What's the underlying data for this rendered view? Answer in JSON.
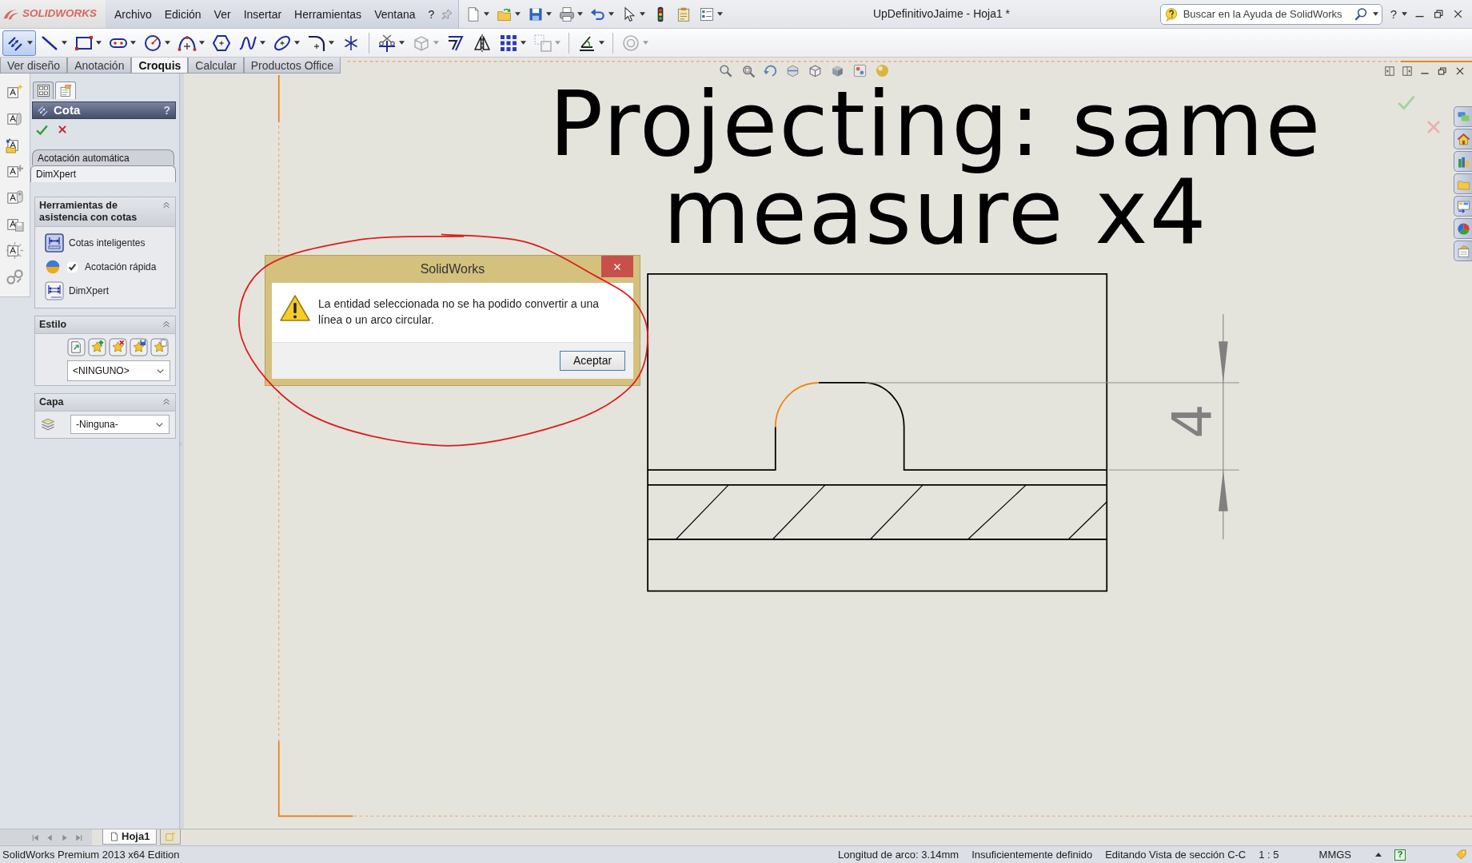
{
  "window": {
    "logo": "SOLIDWORKS",
    "menu": [
      "Archivo",
      "Edición",
      "Ver",
      "Insertar",
      "Herramientas",
      "Ventana",
      "?"
    ],
    "quick_toolbar": [
      {
        "kind": "new",
        "dropdown": true
      },
      {
        "kind": "open",
        "dropdown": true
      },
      {
        "kind": "save",
        "dropdown": true
      },
      {
        "kind": "print",
        "dropdown": true
      },
      {
        "kind": "undo",
        "dropdown": true
      },
      {
        "kind": "select",
        "dropdown": true
      },
      {
        "kind": "rebuild",
        "dropdown": false
      },
      {
        "kind": "options",
        "dropdown": false
      },
      {
        "kind": "properties",
        "dropdown": true
      }
    ],
    "title": "UpDefinitivoJaime - Hoja1 *",
    "search": {
      "placeholder": "Buscar en la Ayuda de SolidWorks"
    },
    "help": "?"
  },
  "sketch_toolbar": {
    "groups": [
      {
        "tools": [
          {
            "kind": "dimension",
            "selected": true,
            "disabled": false,
            "dropdown": true
          },
          {
            "kind": "line",
            "selected": false,
            "disabled": false,
            "dropdown": true
          },
          {
            "kind": "rectangle",
            "selected": false,
            "disabled": false,
            "dropdown": true
          },
          {
            "kind": "slot",
            "selected": false,
            "disabled": false,
            "dropdown": true
          },
          {
            "kind": "circle",
            "selected": false,
            "disabled": false,
            "dropdown": true
          },
          {
            "kind": "arc",
            "selected": false,
            "disabled": false,
            "dropdown": true
          },
          {
            "kind": "polygon",
            "selected": false,
            "disabled": false,
            "dropdown": false
          },
          {
            "kind": "spline",
            "selected": false,
            "disabled": false,
            "dropdown": true
          },
          {
            "kind": "ellipse",
            "selected": false,
            "disabled": false,
            "dropdown": true
          },
          {
            "kind": "fillet",
            "selected": false,
            "disabled": false,
            "dropdown": true
          },
          {
            "kind": "point",
            "selected": false,
            "disabled": false,
            "dropdown": false
          }
        ]
      },
      {
        "tools": [
          {
            "kind": "trim",
            "selected": false,
            "disabled": false,
            "dropdown": true
          },
          {
            "kind": "convert",
            "selected": false,
            "disabled": true,
            "dropdown": true
          },
          {
            "kind": "offset",
            "selected": false,
            "disabled": false,
            "dropdown": false
          },
          {
            "kind": "mirror",
            "selected": false,
            "disabled": false,
            "dropdown": false
          },
          {
            "kind": "pattern",
            "selected": false,
            "disabled": false,
            "dropdown": true
          },
          {
            "kind": "move",
            "selected": false,
            "disabled": true,
            "dropdown": true
          }
        ]
      },
      {
        "tools": [
          {
            "kind": "relations",
            "selected": false,
            "disabled": false,
            "dropdown": true
          }
        ]
      },
      {
        "tools": [
          {
            "kind": "repair",
            "selected": false,
            "disabled": true,
            "dropdown": true
          }
        ]
      }
    ]
  },
  "command_tabs": [
    {
      "label": "Ver diseño",
      "selected": false
    },
    {
      "label": "Anotación",
      "selected": false
    },
    {
      "label": "Croquis",
      "selected": true
    },
    {
      "label": "Calcular",
      "selected": false
    },
    {
      "label": "Productos Office",
      "selected": false
    }
  ],
  "property_manager": {
    "panel_tabs": [
      {
        "kind": "tree",
        "selected": false
      },
      {
        "kind": "properties",
        "selected": true
      }
    ],
    "title": "Cota",
    "help": "?",
    "tabs": [
      {
        "label": "Acotación automática",
        "selected": false
      },
      {
        "label": "DimXpert",
        "selected": true
      }
    ],
    "groups": [
      {
        "kind": "tools",
        "title": "Herramientas de asistencia con cotas",
        "expanded": true,
        "items": [
          {
            "kind": "smart",
            "label": "Cotas inteligentes",
            "selected": true
          },
          {
            "kind": "checkbox",
            "label": "Acotación rápida",
            "checked": true
          },
          {
            "kind": "dimxpert",
            "label": "DimXpert",
            "selected": false
          }
        ]
      },
      {
        "kind": "style",
        "title": "Estilo",
        "expanded": true,
        "value": "<NINGUNO>"
      },
      {
        "kind": "layer",
        "title": "Capa",
        "expanded": true,
        "value": "-Ninguna-"
      }
    ]
  },
  "graphics_area": {
    "note_lines": [
      "Projecting: same",
      "measure x4"
    ],
    "arc_selected": true,
    "dimension": "4",
    "dialog": {
      "title": "SolidWorks",
      "message": "La entidad seleccionada no se ha podido convertir a una línea o un arco circular.",
      "buttons": [
        {
          "label": "Aceptar",
          "default": true
        }
      ]
    }
  },
  "sheet_tabs": [
    {
      "label": "Hoja1",
      "selected": true
    }
  ],
  "status_bar": {
    "edition": "SolidWorks Premium 2013 x64 Edition",
    "fields": [
      "Longitud de arco: 3.14mm",
      "Insuficientemente definido",
      "Editando Vista de sección C-C",
      "1 : 5",
      "MMGS"
    ],
    "help": "?"
  }
}
